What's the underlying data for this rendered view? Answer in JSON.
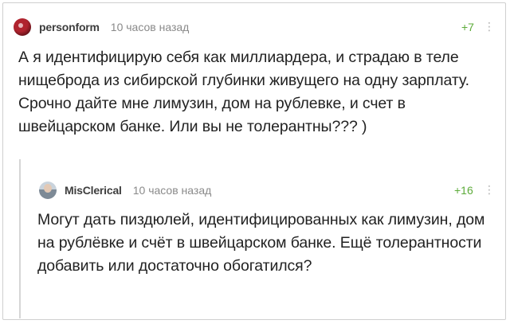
{
  "comments": [
    {
      "username": "personform",
      "time": "10 часов назад",
      "rating": "+7",
      "text": "А я идентифицирую себя как миллиардера, и страдаю в теле нищеброда из сибирской глубинки живущего на одну зарплату. Срочно дайте мне лимузин, дом на рублевке, и счет в швейцарском банке. Или вы не толерантны??? )"
    },
    {
      "username": "MisClerical",
      "time": "10 часов назад",
      "rating": "+16",
      "text": "Могут дать пиздюлей, идентифицированных как лимузин, дом на рублёвке и счёт в швейцарском банке. Ещё толерантности добавить или достаточно обогатился?"
    }
  ],
  "icons": {
    "more": "vertical-ellipsis-icon"
  },
  "colors": {
    "rating": "#5dab3a",
    "meta": "#8a8a8a"
  }
}
